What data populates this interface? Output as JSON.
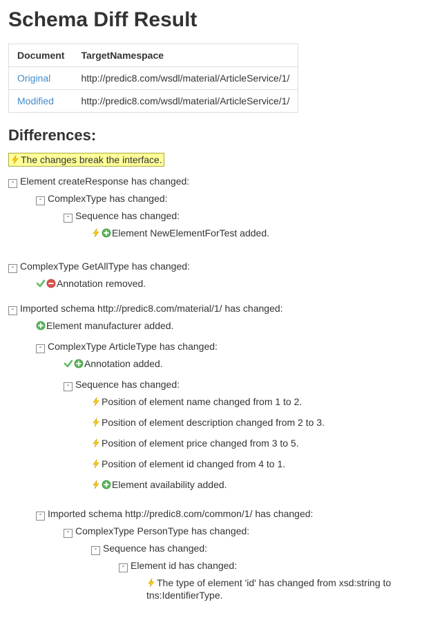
{
  "title": "Schema Diff Result",
  "table": {
    "headers": [
      "Document",
      "TargetNamespace"
    ],
    "rows": [
      {
        "doc": "Original",
        "ns": "http://predic8.com/wsdl/material/ArticleService/1/",
        "link": true
      },
      {
        "doc": "Modified",
        "ns": "http://predic8.com/wsdl/material/ArticleService/1/",
        "link": true
      }
    ]
  },
  "differences_heading": "Differences:",
  "break_banner": "The changes break the interface.",
  "tree": [
    {
      "label": "Element createResponse has changed:",
      "toggle": true,
      "children": [
        {
          "label": "ComplexType has changed:",
          "toggle": true,
          "children": [
            {
              "label": "Sequence has changed:",
              "toggle": true,
              "children": [
                {
                  "label": "Element NewElementForTest added.",
                  "icons": [
                    "bolt",
                    "plus"
                  ]
                }
              ]
            }
          ]
        }
      ]
    },
    {
      "label": "ComplexType GetAllType has changed:",
      "toggle": true,
      "children": [
        {
          "label": "Annotation removed.",
          "icons": [
            "check",
            "minus"
          ]
        }
      ]
    },
    {
      "label": "Imported schema http://predic8.com/material/1/ has changed:",
      "toggle": true,
      "children": [
        {
          "label": "Element manufacturer added.",
          "icons": [
            "plus"
          ]
        },
        {
          "label": "ComplexType ArticleType has changed:",
          "toggle": true,
          "children": [
            {
              "label": "Annotation added.",
              "icons": [
                "check",
                "plus"
              ]
            },
            {
              "label": "Sequence has changed:",
              "toggle": true,
              "children": [
                {
                  "label": "Position of element name changed from 1 to 2.",
                  "icons": [
                    "bolt"
                  ]
                },
                {
                  "label": "Position of element description changed from 2 to 3.",
                  "icons": [
                    "bolt"
                  ]
                },
                {
                  "label": "Position of element price changed from 3 to 5.",
                  "icons": [
                    "bolt"
                  ]
                },
                {
                  "label": "Position of element id changed from 4 to 1.",
                  "icons": [
                    "bolt"
                  ]
                },
                {
                  "label": "Element availability added.",
                  "icons": [
                    "bolt",
                    "plus"
                  ]
                }
              ]
            }
          ]
        },
        {
          "label": "Imported schema http://predic8.com/common/1/ has changed:",
          "toggle": true,
          "children": [
            {
              "label": "ComplexType PersonType has changed:",
              "toggle": true,
              "children": [
                {
                  "label": "Sequence has changed:",
                  "toggle": true,
                  "children": [
                    {
                      "label": "Element id has changed:",
                      "toggle": true,
                      "children": [
                        {
                          "label": "The type of element 'id' has changed from xsd:string to tns:IdentifierType.",
                          "icons": [
                            "bolt"
                          ]
                        }
                      ]
                    }
                  ]
                }
              ]
            }
          ]
        }
      ]
    }
  ]
}
